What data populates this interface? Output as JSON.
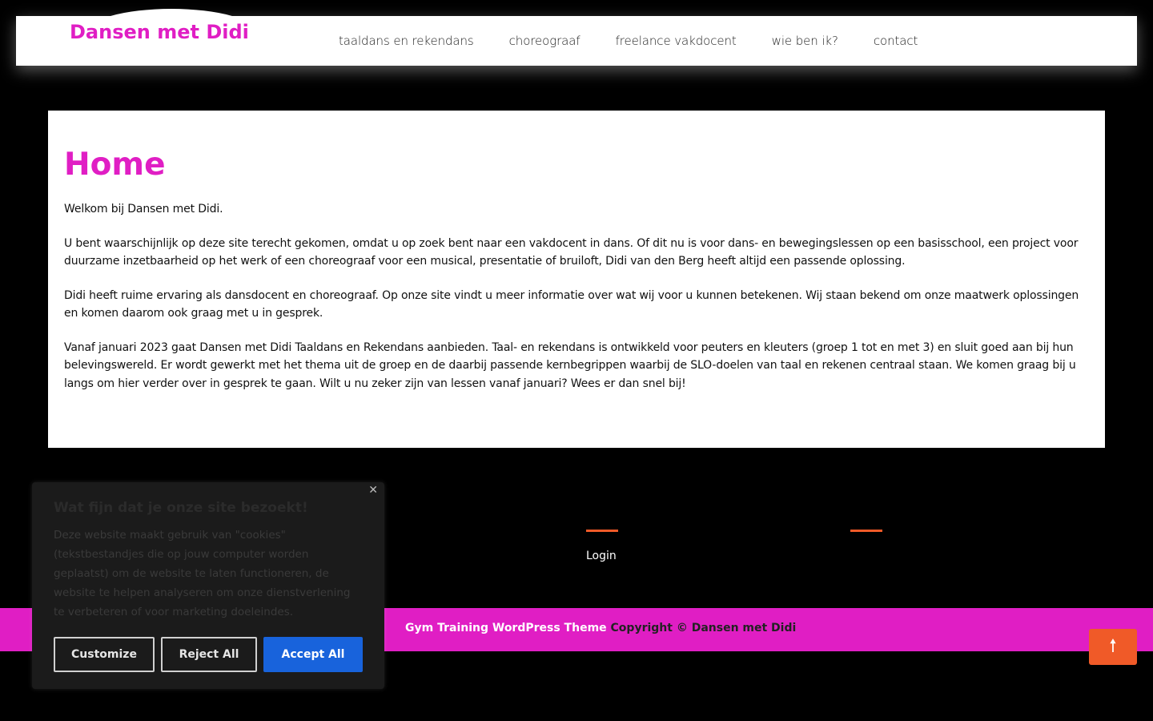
{
  "header": {
    "logo": "Dansen met Didi",
    "nav": [
      {
        "label": "taaldans en rekendans"
      },
      {
        "label": "choreograaf"
      },
      {
        "label": "freelance vakdocent"
      },
      {
        "label": "wie ben ik?"
      },
      {
        "label": "contact"
      }
    ]
  },
  "main": {
    "title": "Home",
    "paragraphs": [
      "Welkom bij Dansen met Didi.",
      "U bent waarschijnlijk op deze site terecht gekomen, omdat u op zoek bent naar een vakdocent in dans. Of dit nu is voor dans- en bewegingslessen op een basisschool, een project voor duurzame inzetbaarheid op het werk of een choreograaf voor een musical, presentatie of bruiloft, Didi van den Berg heeft altijd een passende oplossing.",
      "Didi heeft ruime ervaring als dansdocent en choreograaf. Op onze site vindt u meer informatie over wat wij voor u kunnen betekenen. Wij staan bekend om onze maatwerk oplossingen en komen daarom ook graag met u in gesprek.",
      "Vanaf januari 2023 gaat Dansen met Didi Taaldans en Rekendans aanbieden. Taal- en rekendans is ontwikkeld voor peuters en kleuters (groep 1 tot en met 3) en sluit goed aan bij hun belevingswereld. Er wordt gewerkt met het thema uit de groep en de daarbij passende kernbegrippen waarbij de SLO-doelen van taal en rekenen centraal staan. We komen graag bij u langs om hier verder over in gesprek te gaan. Wilt u nu zeker zijn van lessen vanaf januari? Wees er dan snel bij!"
    ]
  },
  "footer": {
    "login": "Login",
    "theme_link": "Gym Training WordPress Theme",
    "copyright": "Copyright © Dansen met Didi",
    "scroll_top_icon": "arrow-up-icon"
  },
  "cookie": {
    "close_icon": "close-icon",
    "title": "Wat fijn dat je onze site bezoekt!",
    "description": "Deze website maakt gebruik van \"cookies\" (tekstbestandjes die op jouw computer worden geplaatst) om de website te laten functioneren, de website te helpen analyseren om onze dienstverlening te verbeteren of voor marketing doeleindes.",
    "customize": "Customize",
    "reject": "Reject All",
    "accept": "Accept All"
  },
  "colors": {
    "accent": "#e01ec4",
    "orange": "#f05a28",
    "accept_blue": "#1863dc"
  }
}
